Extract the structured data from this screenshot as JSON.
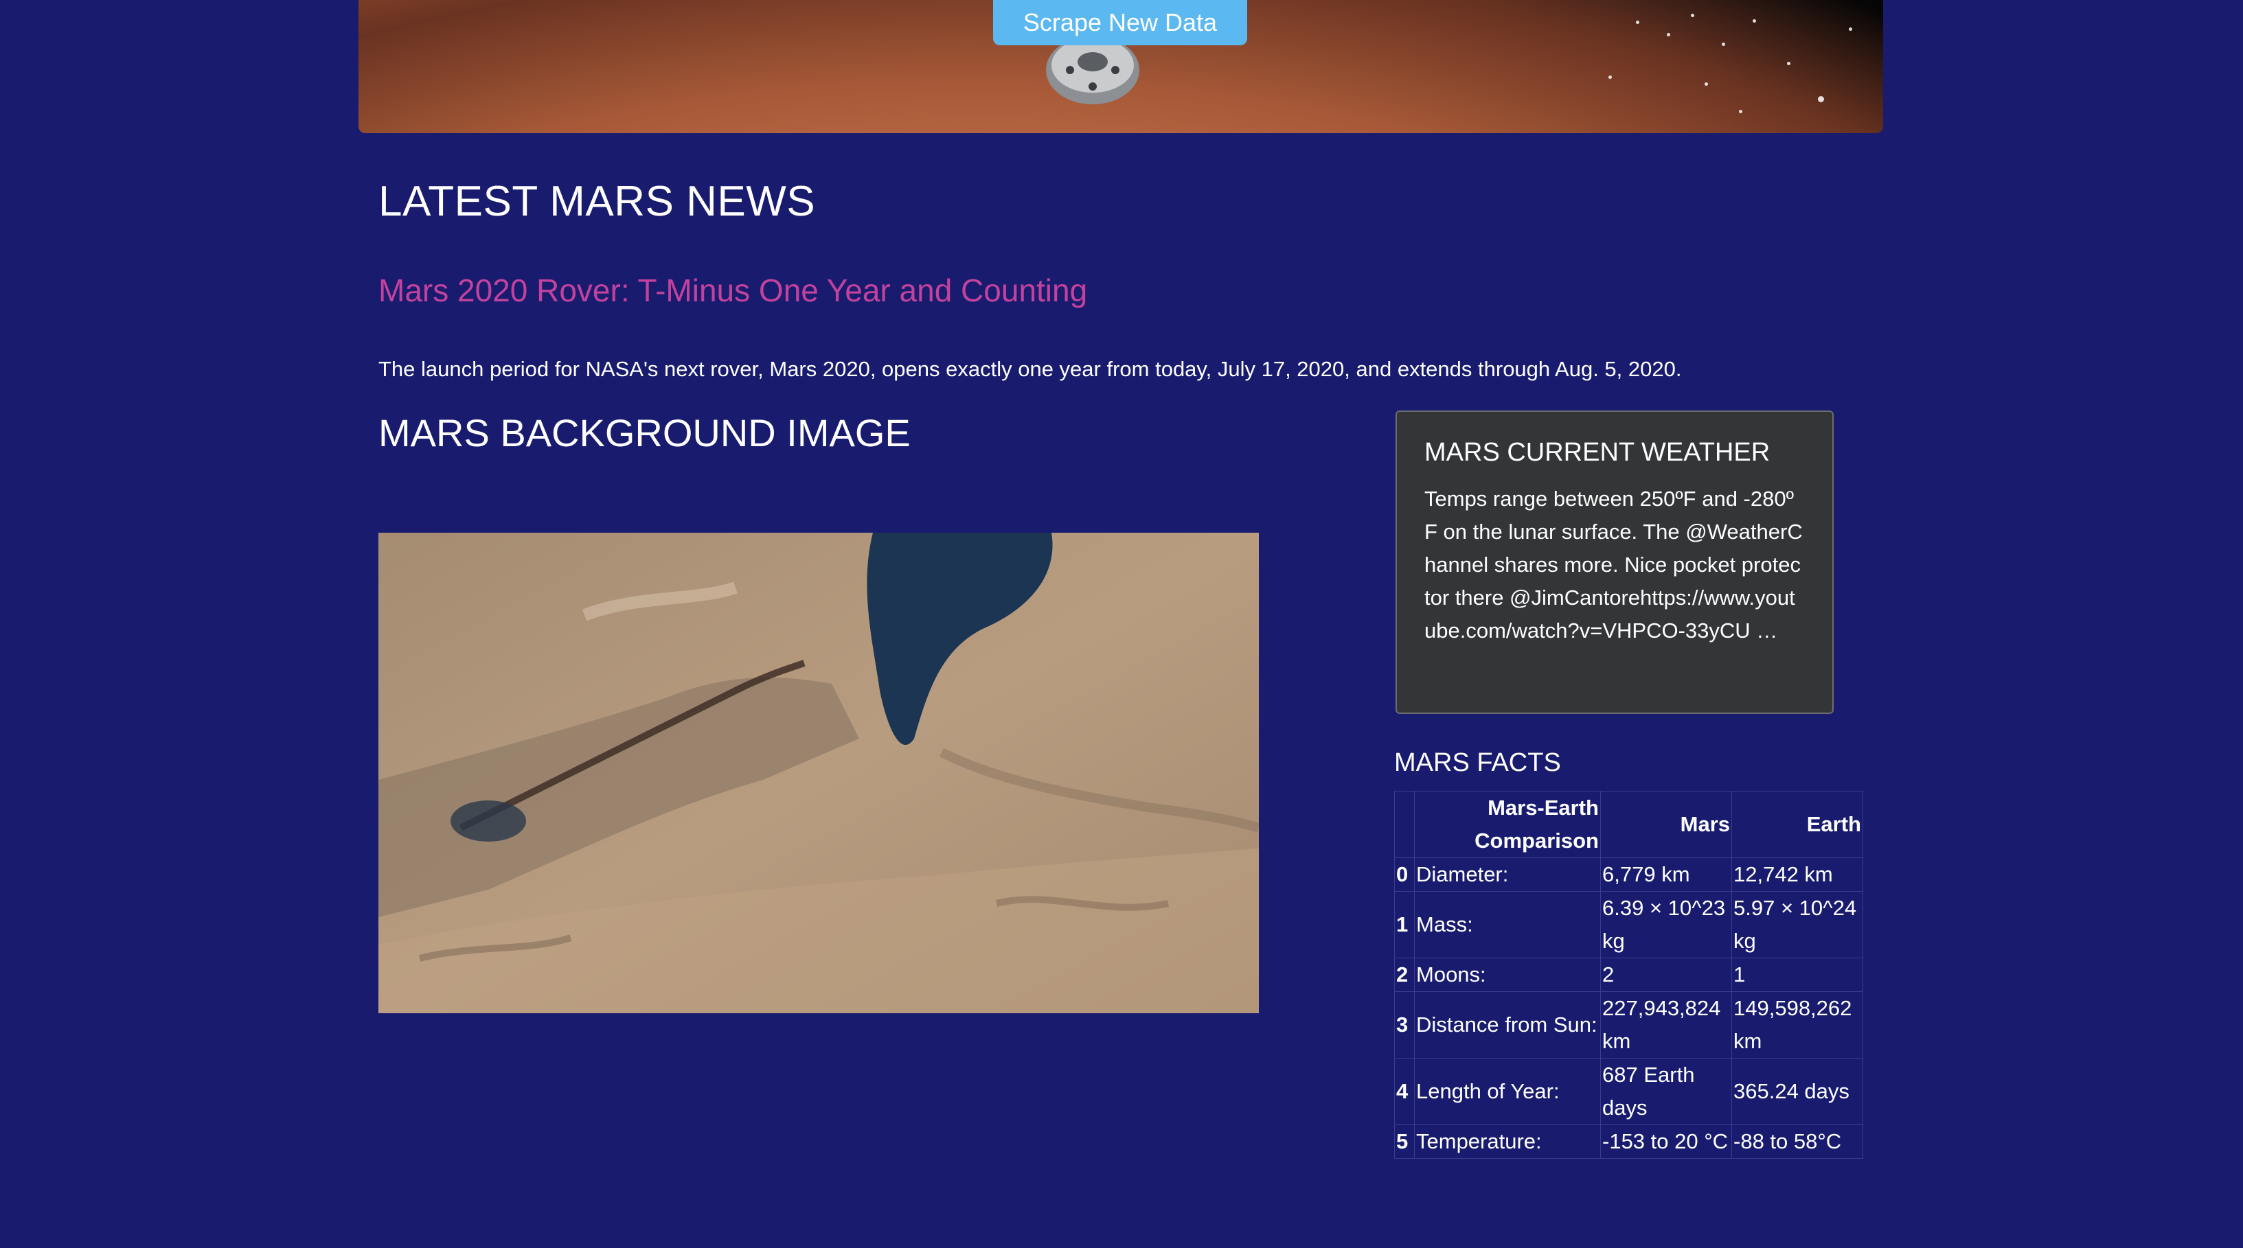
{
  "header": {
    "scrape_button_label": "Scrape New Data"
  },
  "news": {
    "heading": "LATEST MARS NEWS",
    "title": "Mars 2020 Rover: T-Minus One Year and Counting",
    "paragraph": "The launch period for NASA's next rover, Mars 2020, opens exactly one year from today, July 17, 2020, and extends through Aug. 5, 2020."
  },
  "featured_image": {
    "heading": "MARS BACKGROUND IMAGE"
  },
  "weather": {
    "heading": "MARS CURRENT WEATHER",
    "text": "Temps range between 250ºF and -280ºF on the lunar surface. The @WeatherChannel shares more. Nice pocket protector there @JimCantorehttps://www.youtube.com/watch?v=VHPCO-33yCU …"
  },
  "facts": {
    "heading": "MARS FACTS",
    "columns": [
      "",
      "Mars-Earth Comparison",
      "Mars",
      "Earth"
    ],
    "rows": [
      {
        "index": "0",
        "label": "Diameter:",
        "mars": "6,779 km",
        "earth": "12,742 km"
      },
      {
        "index": "1",
        "label": "Mass:",
        "mars": "6.39 × 10^23 kg",
        "earth": "5.97 × 10^24 kg"
      },
      {
        "index": "2",
        "label": "Moons:",
        "mars": "2",
        "earth": "1"
      },
      {
        "index": "3",
        "label": "Distance from Sun:",
        "mars": "227,943,824 km",
        "earth": "149,598,262 km"
      },
      {
        "index": "4",
        "label": "Length of Year:",
        "mars": "687 Earth days",
        "earth": "365.24 days"
      },
      {
        "index": "5",
        "label": "Temperature:",
        "mars": "-153 to 20 °C",
        "earth": "-88 to 58°C"
      }
    ]
  }
}
